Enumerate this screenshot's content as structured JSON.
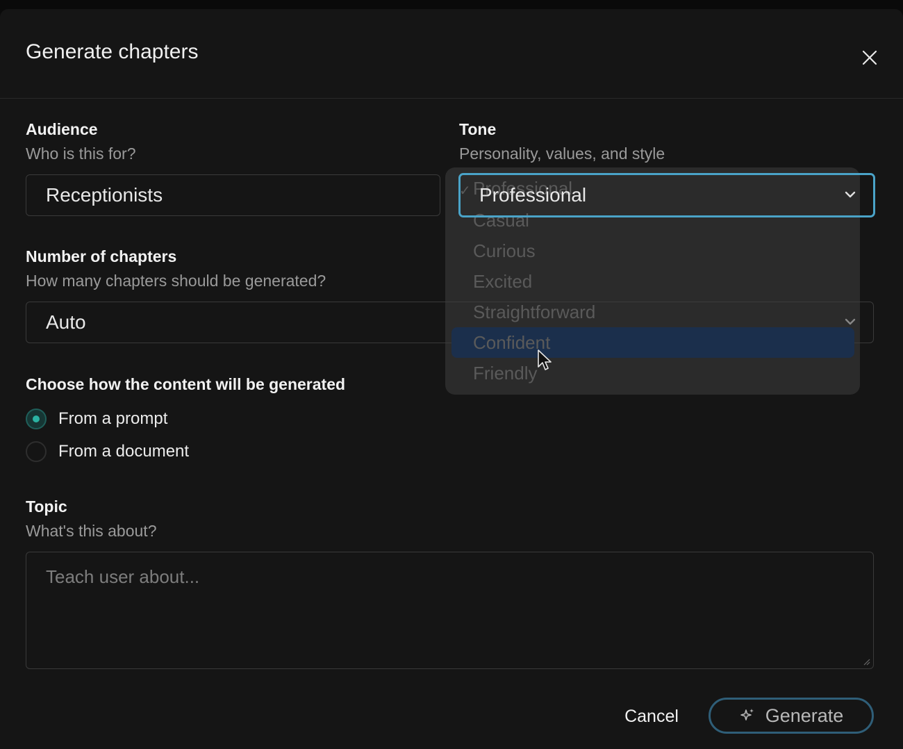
{
  "dialog": {
    "title": "Generate chapters",
    "close_icon": "close-icon"
  },
  "audience": {
    "label": "Audience",
    "sublabel": "Who is this for?",
    "value": "Receptionists"
  },
  "tone": {
    "label": "Tone",
    "sublabel": "Personality, values, and style",
    "selected": "Professional",
    "options": [
      "Professional",
      "Casual",
      "Curious",
      "Excited",
      "Straightforward",
      "Confident",
      "Friendly"
    ],
    "hovered": "Confident"
  },
  "chapters": {
    "label": "Number of chapters",
    "sublabel": "How many chapters should be generated?",
    "value": "Auto"
  },
  "generation": {
    "label": "Choose how the content will be generated",
    "options": [
      {
        "label": "From a prompt",
        "checked": true
      },
      {
        "label": "From a document",
        "checked": false
      }
    ]
  },
  "topic": {
    "label": "Topic",
    "sublabel": "What's this about?",
    "placeholder": "Teach user about..."
  },
  "footer": {
    "cancel_label": "Cancel",
    "generate_label": "Generate",
    "generate_icon": "sparkle-icon"
  },
  "colors": {
    "accent": "#4aa3c8",
    "radio_accent": "#2bb3a3",
    "hover_bg": "#1b2f4c"
  }
}
